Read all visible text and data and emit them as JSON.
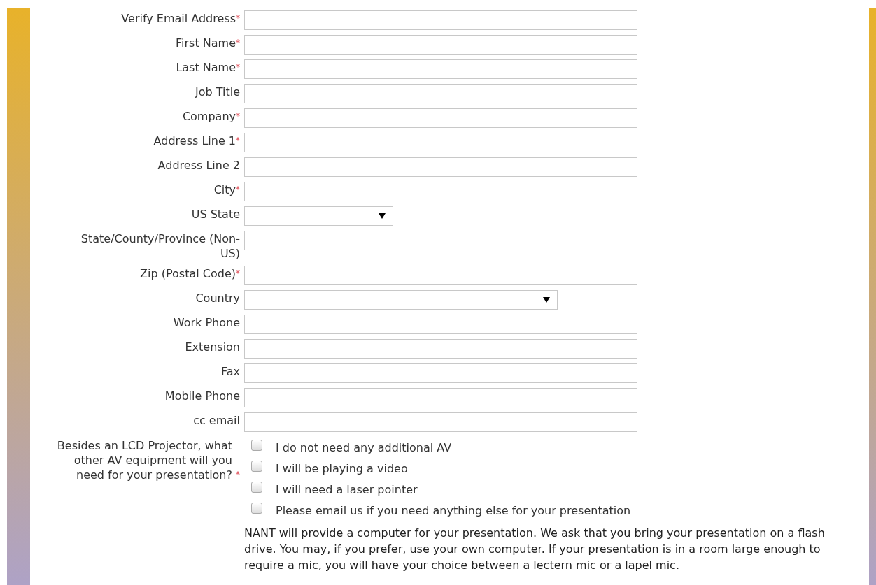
{
  "fields": [
    {
      "kind": "text",
      "label": "Verify Email Address",
      "required_mark": "*"
    },
    {
      "kind": "text",
      "label": "First Name",
      "required_mark": "*"
    },
    {
      "kind": "text",
      "label": "Last Name",
      "required_mark": "*"
    },
    {
      "kind": "text",
      "label": "Job Title"
    },
    {
      "kind": "text",
      "label": "Company",
      "required_mark": "*"
    },
    {
      "kind": "text",
      "label": "Address Line 1",
      "required_mark": "*"
    },
    {
      "kind": "text",
      "label": "Address Line 2"
    },
    {
      "kind": "text",
      "label": "City",
      "required_mark": "*"
    },
    {
      "kind": "select",
      "wide": false,
      "label": "US State"
    },
    {
      "kind": "text",
      "label": "State/County/Province (Non-US)"
    },
    {
      "kind": "text",
      "label": "Zip (Postal Code)",
      "required_mark": "*"
    },
    {
      "kind": "select",
      "wide": true,
      "label": "Country"
    },
    {
      "kind": "text",
      "label": "Work Phone"
    },
    {
      "kind": "text",
      "label": "Extension"
    },
    {
      "kind": "text",
      "label": "Fax"
    },
    {
      "kind": "text",
      "label": "Mobile Phone"
    },
    {
      "kind": "text",
      "label": "cc email"
    }
  ],
  "av_question": {
    "label": "Besides an LCD Projector, what other AV equipment will you need for your presentation?",
    "required_mark": "*",
    "options": [
      {
        "label": "I do not need any additional AV",
        "checked": false
      },
      {
        "label": "I will be playing a video",
        "checked": false
      },
      {
        "label": "I will need a laser pointer",
        "checked": false
      },
      {
        "label": "Please email us if you need anything else for your presentation",
        "checked": false
      }
    ],
    "note": "NANT will provide a computer for your presentation. We ask that you bring your presentation on a flash drive. You may, if you prefer, use your own computer.  If your presentation is in a room large enough to require a mic, you will have your choice between a lectern mic or a lapel mic."
  }
}
